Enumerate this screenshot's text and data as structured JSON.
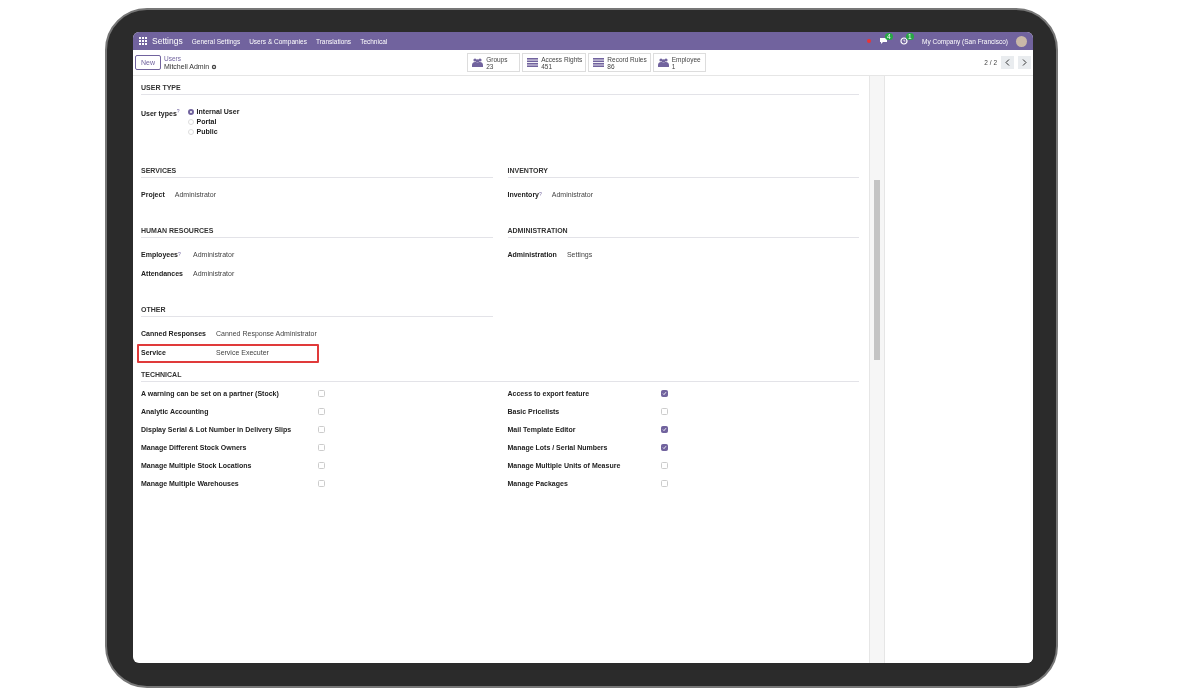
{
  "navbar": {
    "app_name": "Settings",
    "menus": [
      "General Settings",
      "Users & Companies",
      "Translations",
      "Technical"
    ],
    "messages_badge": "4",
    "activities_badge": "1",
    "company": "My Company (San Francisco)"
  },
  "control_panel": {
    "new_button": "New",
    "breadcrumb_parent": "Users",
    "breadcrumb_current": "Mitchell Admin",
    "stat_buttons": [
      {
        "label": "Groups",
        "count": "23",
        "kind": "users"
      },
      {
        "label": "Access Rights",
        "count": "451",
        "kind": "list"
      },
      {
        "label": "Record Rules",
        "count": "86",
        "kind": "list"
      },
      {
        "label": "Employee",
        "count": "1",
        "kind": "users"
      }
    ],
    "pager": "2 / 2"
  },
  "user_type": {
    "title": "USER TYPE",
    "label": "User types",
    "help": "?",
    "options": [
      {
        "label": "Internal User",
        "selected": true
      },
      {
        "label": "Portal",
        "selected": false
      },
      {
        "label": "Public",
        "selected": false
      }
    ]
  },
  "left_sections": [
    {
      "title": "SERVICES",
      "fields": [
        {
          "label": "Project",
          "value": "Administrator",
          "highlighted": false
        }
      ]
    },
    {
      "title": "HUMAN RESOURCES",
      "fields": [
        {
          "label": "Employees",
          "help": "?",
          "value": "Administrator",
          "highlighted": false
        },
        {
          "label": "Attendances",
          "value": "Administrator",
          "highlighted": false
        }
      ]
    },
    {
      "title": "OTHER",
      "fields": [
        {
          "label": "Canned Responses",
          "value": "Canned Response Administrator",
          "highlighted": false
        },
        {
          "label": "Service",
          "value": "Service Executer",
          "highlighted": true
        }
      ]
    }
  ],
  "right_sections": [
    {
      "title": "INVENTORY",
      "fields": [
        {
          "label": "Inventory",
          "help": "?",
          "value": "Administrator",
          "highlighted": false
        }
      ]
    },
    {
      "title": "ADMINISTRATION",
      "fields": [
        {
          "label": "Administration",
          "value": "Settings",
          "highlighted": false
        }
      ]
    }
  ],
  "technical": {
    "title": "TECHNICAL",
    "left_items": [
      {
        "label": "A warning can be set on a partner (Stock)",
        "checked": false
      },
      {
        "label": "Analytic Accounting",
        "checked": false
      },
      {
        "label": "Display Serial & Lot Number in Delivery Slips",
        "checked": false
      },
      {
        "label": "Manage Different Stock Owners",
        "checked": false
      },
      {
        "label": "Manage Multiple Stock Locations",
        "checked": false
      },
      {
        "label": "Manage Multiple Warehouses",
        "checked": false
      }
    ],
    "right_items": [
      {
        "label": "Access to export feature",
        "checked": true
      },
      {
        "label": "Basic Pricelists",
        "checked": false
      },
      {
        "label": "Mail Template Editor",
        "checked": true
      },
      {
        "label": "Manage Lots / Serial Numbers",
        "checked": true
      },
      {
        "label": "Manage Multiple Units of Measure",
        "checked": false
      },
      {
        "label": "Manage Packages",
        "checked": false
      }
    ]
  }
}
